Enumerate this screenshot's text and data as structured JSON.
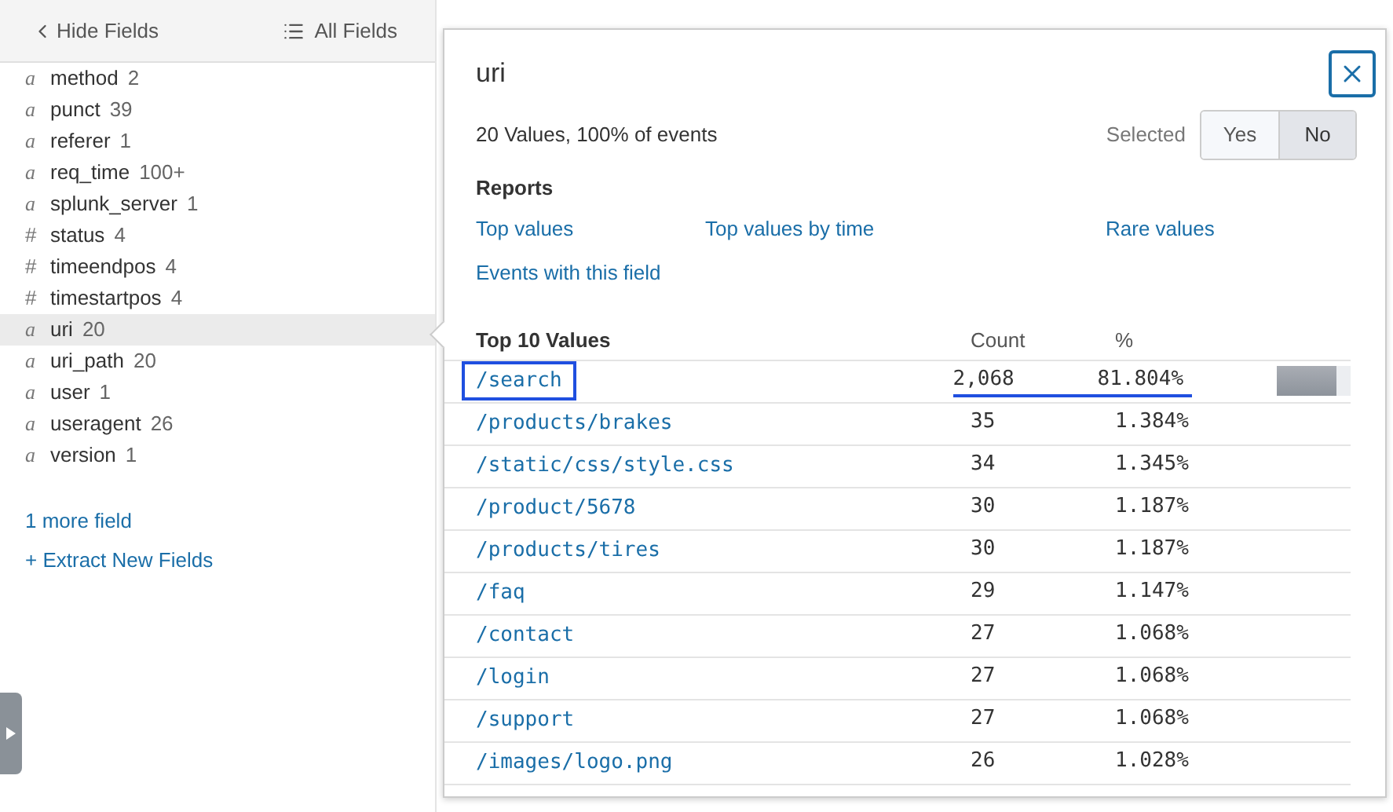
{
  "sidebar": {
    "hide_button": "Hide Fields",
    "all_fields_button": "All Fields",
    "fields": [
      {
        "type": "a",
        "name": "method",
        "count": "2",
        "selected": false
      },
      {
        "type": "a",
        "name": "punct",
        "count": "39",
        "selected": false
      },
      {
        "type": "a",
        "name": "referer",
        "count": "1",
        "selected": false
      },
      {
        "type": "a",
        "name": "req_time",
        "count": "100+",
        "selected": false
      },
      {
        "type": "a",
        "name": "splunk_server",
        "count": "1",
        "selected": false
      },
      {
        "type": "#",
        "name": "status",
        "count": "4",
        "selected": false
      },
      {
        "type": "#",
        "name": "timeendpos",
        "count": "4",
        "selected": false
      },
      {
        "type": "#",
        "name": "timestartpos",
        "count": "4",
        "selected": false
      },
      {
        "type": "a",
        "name": "uri",
        "count": "20",
        "selected": true
      },
      {
        "type": "a",
        "name": "uri_path",
        "count": "20",
        "selected": false
      },
      {
        "type": "a",
        "name": "user",
        "count": "1",
        "selected": false
      },
      {
        "type": "a",
        "name": "useragent",
        "count": "26",
        "selected": false
      },
      {
        "type": "a",
        "name": "version",
        "count": "1",
        "selected": false
      }
    ],
    "more_fields": "1 more field",
    "extract_link": "+ Extract New Fields"
  },
  "popup": {
    "title": "uri",
    "summary": "20 Values, 100% of events",
    "selected_label": "Selected",
    "selected_options": [
      {
        "label": "Yes",
        "selected": false
      },
      {
        "label": "No",
        "selected": true
      }
    ],
    "reports_heading": "Reports",
    "reports": [
      "Top values",
      "Top values by time",
      "Rare values",
      "Events with this field"
    ],
    "table": {
      "columns": [
        "Top 10 Values",
        "Count",
        "%"
      ],
      "rows": [
        {
          "value": "/search",
          "count": "2,068",
          "percent": "81.804%",
          "level": 0.818,
          "focused": true
        },
        {
          "value": "/products/brakes",
          "count": "35",
          "percent": "1.384%",
          "focused": false
        },
        {
          "value": "/static/css/style.css",
          "count": "34",
          "percent": "1.345%",
          "focused": false
        },
        {
          "value": "/product/5678",
          "count": "30",
          "percent": "1.187%",
          "focused": false
        },
        {
          "value": "/products/tires",
          "count": "30",
          "percent": "1.187%",
          "focused": false
        },
        {
          "value": "/faq",
          "count": "29",
          "percent": "1.147%",
          "focused": false
        },
        {
          "value": "/contact",
          "count": "27",
          "percent": "1.068%",
          "focused": false
        },
        {
          "value": "/login",
          "count": "27",
          "percent": "1.068%",
          "focused": false
        },
        {
          "value": "/support",
          "count": "27",
          "percent": "1.068%",
          "focused": false
        },
        {
          "value": "/images/logo.png",
          "count": "26",
          "percent": "1.028%",
          "focused": false
        }
      ]
    }
  }
}
